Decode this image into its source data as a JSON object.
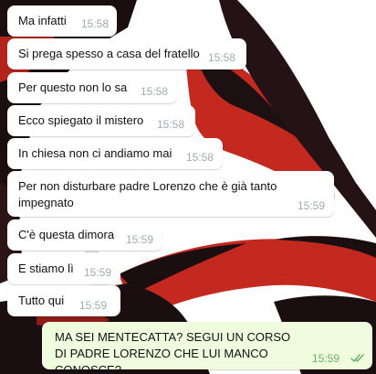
{
  "colors": {
    "incoming_bubble": "#ffffff",
    "outgoing_bubble": "#effdde",
    "timestamp": "#a3a9b0",
    "outgoing_timestamp": "#6ab26a",
    "wallpaper_red": "#c4291f",
    "wallpaper_dark": "#1a0e10"
  },
  "messages": [
    {
      "text": "Ma infatti",
      "time": "15:58",
      "direction": "incoming"
    },
    {
      "text": "Si prega spesso a casa del fratello",
      "time": "15:58",
      "direction": "incoming"
    },
    {
      "text": "Per questo non lo sa",
      "time": "15:58",
      "direction": "incoming"
    },
    {
      "text": "Ecco spiegato il mistero",
      "time": "15:58",
      "direction": "incoming"
    },
    {
      "text": "In chiesa non ci andiamo mai",
      "time": "15:58",
      "direction": "incoming"
    },
    {
      "text": "Per non disturbare padre Lorenzo che è già tanto impegnato",
      "time": "15:59",
      "direction": "incoming"
    },
    {
      "text": "C'è questa dimora",
      "time": "15:59",
      "direction": "incoming"
    },
    {
      "text": "E stiamo lì",
      "time": "15:59",
      "direction": "incoming"
    },
    {
      "text": "Tutto qui",
      "time": "15:59",
      "direction": "incoming"
    },
    {
      "text": "MA SEI MENTECATTA? SEGUI UN CORSO DI PADRE LORENZO CHE LUI MANCO CONOSCE?",
      "time": "15:59",
      "direction": "outgoing",
      "status_icon": "double-check-icon"
    }
  ]
}
